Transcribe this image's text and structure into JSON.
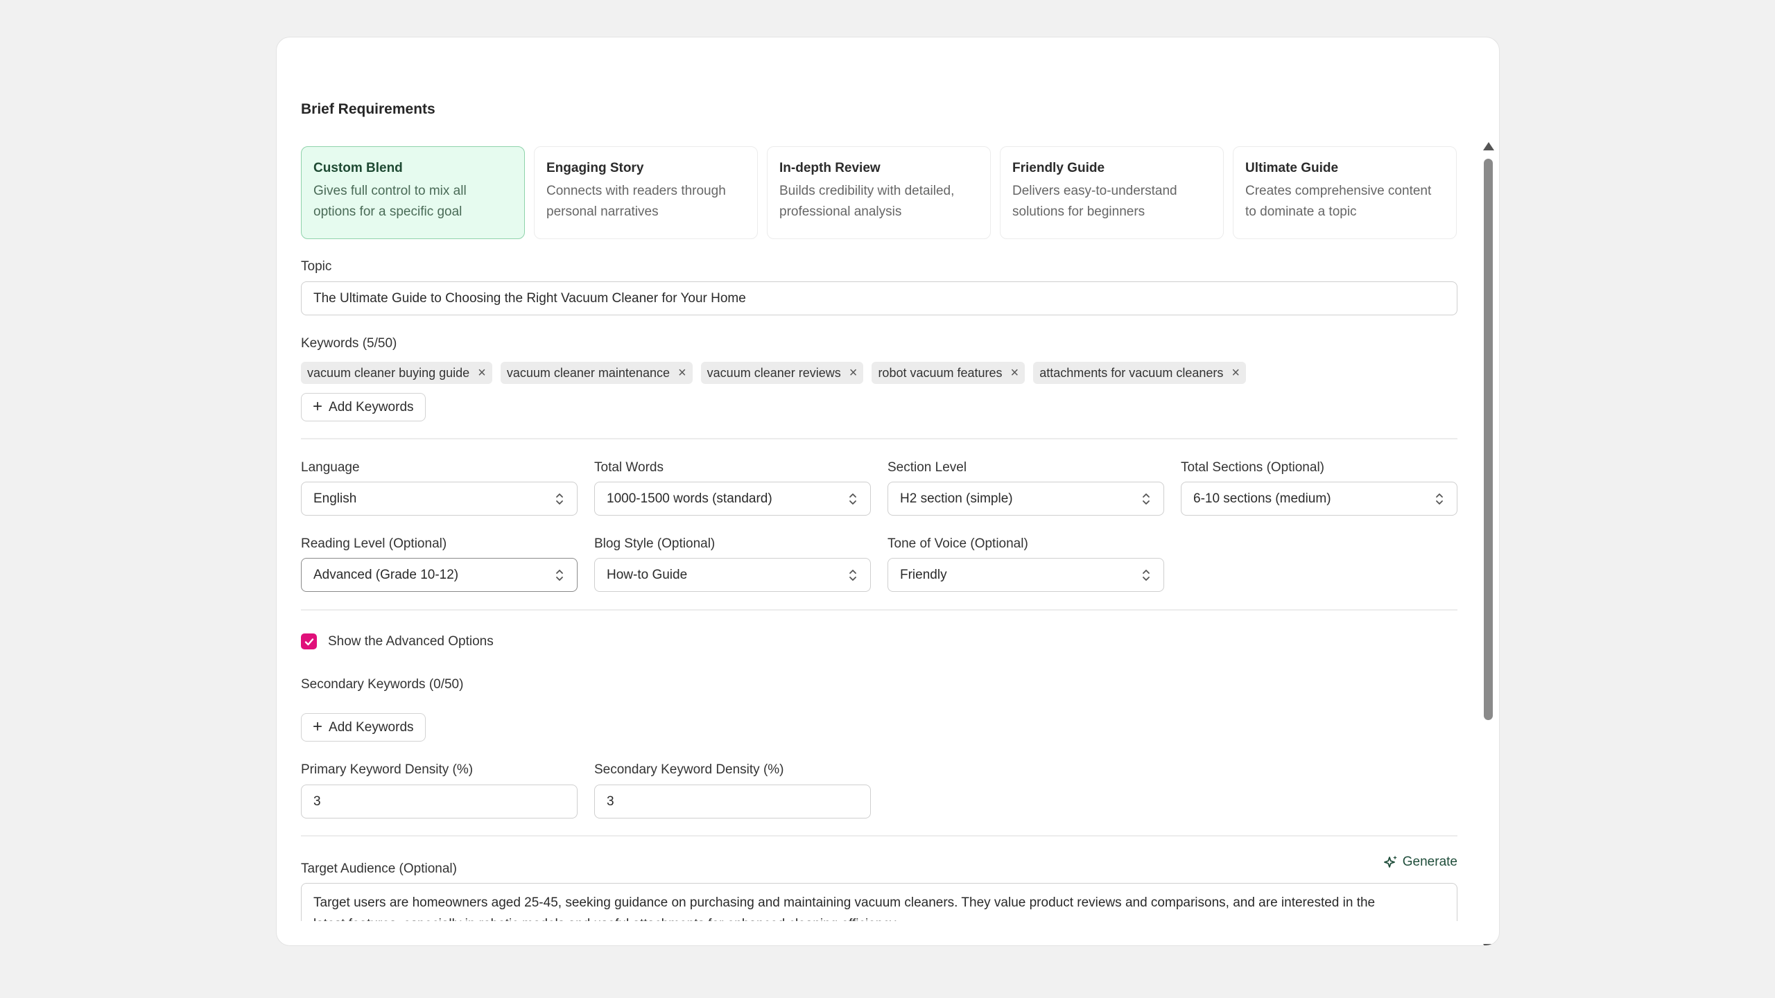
{
  "brief": {
    "title": "Brief Requirements",
    "presets": [
      {
        "title": "Custom Blend",
        "desc_line1": "Gives full control to mix all",
        "desc_line2": "options for a specific goal"
      },
      {
        "title": "Engaging Story",
        "desc_line1": "Connects with readers through",
        "desc_line2": "personal narratives"
      },
      {
        "title": "In-depth Review",
        "desc_line1": "Builds credibility with detailed,",
        "desc_line2": "professional analysis"
      },
      {
        "title": "Friendly Guide",
        "desc_line1": "Delivers easy-to-understand",
        "desc_line2": "solutions for beginners"
      },
      {
        "title": "Ultimate Guide",
        "desc_line1": "Creates comprehensive content",
        "desc_line2": "to dominate a topic"
      }
    ],
    "topic_label": "Topic",
    "topic_value": "The Ultimate Guide to Choosing the Right Vacuum Cleaner for Your Home",
    "keywords_label": "Keywords (5/50)",
    "keywords": [
      "vacuum cleaner buying guide",
      "vacuum cleaner maintenance",
      "vacuum cleaner reviews",
      "robot vacuum features",
      "attachments for vacuum cleaners"
    ],
    "add_keywords_label": "Add Keywords",
    "language_label": "Language",
    "language_value": "English",
    "total_words_label": "Total Words",
    "total_words_value": "1000-1500 words (standard)",
    "section_level_label": "Section Level",
    "section_level_value": "H2 section (simple)",
    "total_sections_label": "Total Sections (Optional)",
    "total_sections_value": "6-10 sections (medium)",
    "reading_level_label": "Reading Level (Optional)",
    "reading_level_value": "Advanced (Grade 10-12)",
    "blog_style_label": "Blog Style (Optional)",
    "blog_style_value": "How-to Guide",
    "tone_label": "Tone of Voice (Optional)",
    "tone_value": "Friendly",
    "advanced_label": "Show the Advanced Options",
    "secondary_keywords_label": "Secondary Keywords (0/50)",
    "primary_density_label": "Primary Keyword Density (%)",
    "primary_density_value": "3",
    "secondary_density_label": "Secondary Keyword Density (%)",
    "secondary_density_value": "3",
    "audience_label": "Target Audience (Optional)",
    "generate_label": "Generate",
    "audience_line1": "Target users are homeowners aged 25-45, seeking guidance on purchasing and maintaining vacuum cleaners. They value product reviews and comparisons, and are interested in the",
    "audience_line2": "latest features, especially in robotic models and useful attachments for enhanced cleaning efficiency."
  },
  "colors": {
    "accent": "#e0107a",
    "active_card_bg": "#e6fbef",
    "active_card_border": "#8fd3ab",
    "generate": "#1f4d3a"
  }
}
